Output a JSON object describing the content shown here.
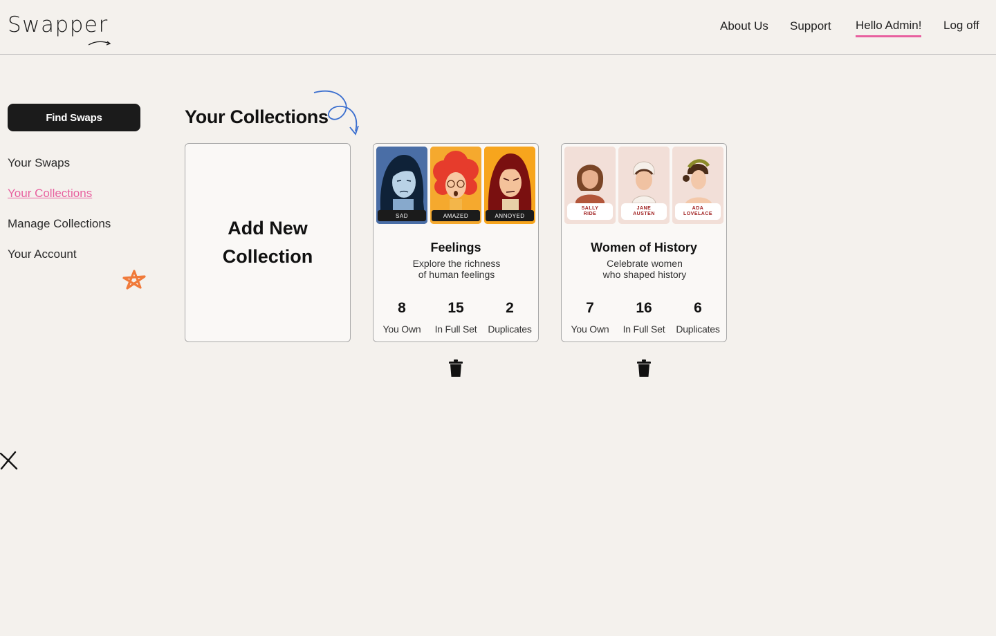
{
  "header": {
    "logo": "Swapper",
    "nav": {
      "about": "About Us",
      "support": "Support",
      "hello": "Hello Admin!",
      "logoff": "Log off"
    }
  },
  "sidebar": {
    "find_swaps": "Find Swaps",
    "items": [
      {
        "label": "Your Swaps"
      },
      {
        "label": "Your Collections",
        "active": true
      },
      {
        "label": "Manage Collections"
      },
      {
        "label": "Your Account"
      }
    ]
  },
  "main": {
    "title": "Your Collections",
    "add_new": "Add New Collection",
    "collections": [
      {
        "name": "Feelings",
        "description_line1": "Explore the richness",
        "description_line2": "of human feelings",
        "thumbs": [
          "SAD",
          "AMAZED",
          "ANNOYED"
        ],
        "stats": [
          {
            "value": "8",
            "label": "You Own"
          },
          {
            "value": "15",
            "label": "In Full Set"
          },
          {
            "value": "2",
            "label": "Duplicates"
          }
        ]
      },
      {
        "name": "Women of History",
        "description_line1": "Celebrate women",
        "description_line2": "who shaped history",
        "thumbs": [
          {
            "line1": "SALLY",
            "line2": "RIDE"
          },
          {
            "line1": "JANE",
            "line2": "AUSTEN"
          },
          {
            "line1": "ADA",
            "line2": "LOVELACE"
          }
        ],
        "stats": [
          {
            "value": "7",
            "label": "You Own"
          },
          {
            "value": "16",
            "label": "In Full Set"
          },
          {
            "value": "6",
            "label": "Duplicates"
          }
        ]
      }
    ]
  },
  "icons": {
    "delete": "trash-icon",
    "decor_star": "star-doodle-icon",
    "decor_arrow": "curly-arrow-icon"
  },
  "colors": {
    "accent": "#e8609f",
    "background": "#f4f1ed",
    "button": "#1b1b1b",
    "star": "#f07a3a",
    "arrow": "#3b6fcf"
  }
}
